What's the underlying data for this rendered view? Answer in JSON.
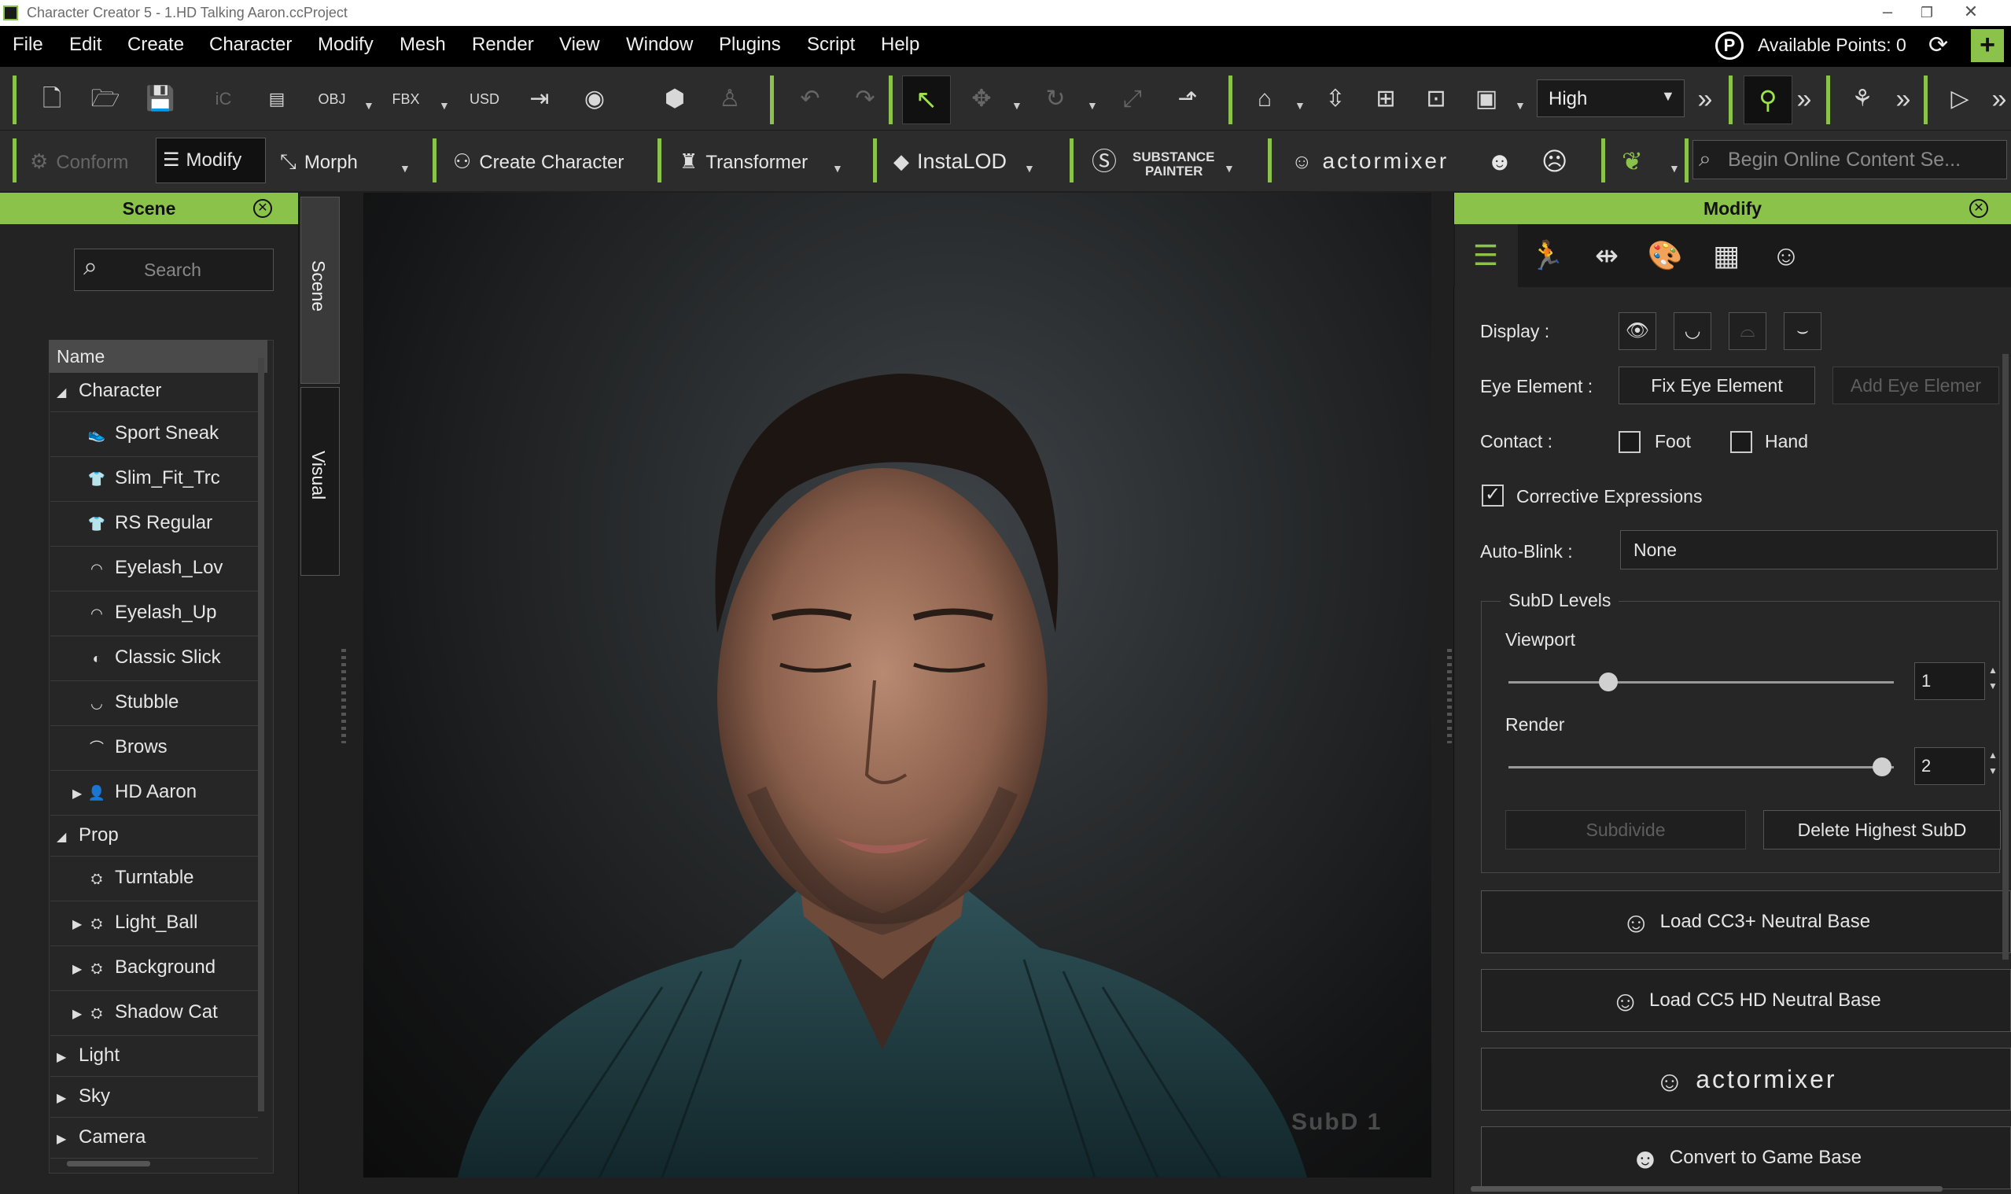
{
  "window": {
    "title": "Character Creator 5 - 1.HD Talking Aaron.ccProject",
    "minimize": "–",
    "restore": "❐",
    "close": "✕"
  },
  "menu": [
    "File",
    "Edit",
    "Create",
    "Character",
    "Modify",
    "Mesh",
    "Render",
    "View",
    "Window",
    "Plugins",
    "Script",
    "Help"
  ],
  "points": {
    "logo": "P",
    "label": "Available Points: 0",
    "plus": "+"
  },
  "toolbar1": {
    "quality": "High",
    "more": "»"
  },
  "toolbar2": {
    "conform": "Conform",
    "modify": "Modify",
    "morph": "Morph",
    "create_character": "Create Character",
    "transformer": "Transformer",
    "instalod": "InstaLOD",
    "substance_top": "SUBSTANCE",
    "substance_bottom": "PAINTER",
    "actormixer": "actormixer",
    "search_placeholder": "Begin Online Content Se..."
  },
  "scene_panel": {
    "title": "Scene",
    "search_placeholder": "Search",
    "column_name": "Name",
    "tree": [
      {
        "label": "Character",
        "level": 0,
        "expander": "◢",
        "icon": ""
      },
      {
        "label": "Sport Sneak",
        "level": 1,
        "expander": "",
        "icon": "shoe-icon"
      },
      {
        "label": "Slim_Fit_Trc",
        "level": 1,
        "expander": "",
        "icon": "shirt-icon"
      },
      {
        "label": "RS Regular",
        "level": 1,
        "expander": "",
        "icon": "shirt-icon"
      },
      {
        "label": "Eyelash_Lov",
        "level": 1,
        "expander": "",
        "icon": "eyelash-icon"
      },
      {
        "label": "Eyelash_Up",
        "level": 1,
        "expander": "",
        "icon": "eyelash-icon"
      },
      {
        "label": "Classic Slick",
        "level": 1,
        "expander": "",
        "icon": "hair-icon"
      },
      {
        "label": "Stubble",
        "level": 1,
        "expander": "",
        "icon": "beard-icon"
      },
      {
        "label": "Brows",
        "level": 1,
        "expander": "",
        "icon": "brow-icon"
      },
      {
        "label": "HD Aaron",
        "level": 1,
        "expander": "▶",
        "icon": "person-icon"
      },
      {
        "label": "Prop",
        "level": 0,
        "expander": "◢",
        "icon": ""
      },
      {
        "label": "Turntable",
        "level": 1,
        "expander": "",
        "icon": "prop-icon"
      },
      {
        "label": "Light_Ball",
        "level": 1,
        "expander": "▶",
        "icon": "prop-icon"
      },
      {
        "label": "Background",
        "level": 1,
        "expander": "▶",
        "icon": "prop-icon"
      },
      {
        "label": "Shadow Cat",
        "level": 1,
        "expander": "▶",
        "icon": "prop-icon"
      },
      {
        "label": "Light",
        "level": 0,
        "expander": "▶",
        "icon": ""
      },
      {
        "label": "Sky",
        "level": 0,
        "expander": "▶",
        "icon": ""
      },
      {
        "label": "Camera",
        "level": 0,
        "expander": "▶",
        "icon": ""
      }
    ]
  },
  "side_tabs": {
    "scene": "Scene",
    "visual": "Visual"
  },
  "viewport": {
    "subd_label": "SubD 1"
  },
  "modify_panel": {
    "title": "Modify",
    "display_label": "Display :",
    "eye_element_label": "Eye Element :",
    "fix_eye": "Fix Eye Element",
    "add_eye": "Add Eye Elemer",
    "contact_label": "Contact :",
    "foot": "Foot",
    "hand": "Hand",
    "corrective": "Corrective Expressions",
    "autoblink_label": "Auto-Blink :",
    "autoblink_value": "None",
    "subd_group": "SubD Levels",
    "viewport_label": "Viewport",
    "viewport_value": "1",
    "viewport_level": 0.26,
    "render_label": "Render",
    "render_value": "2",
    "render_level": 0.97,
    "subdivide": "Subdivide",
    "delete_subd": "Delete Highest SubD",
    "load_cc3": "Load CC3+ Neutral Base",
    "load_cc5": "Load CC5 HD Neutral Base",
    "actormixer": "actormixer",
    "convert_game": "Convert to Game Base"
  }
}
